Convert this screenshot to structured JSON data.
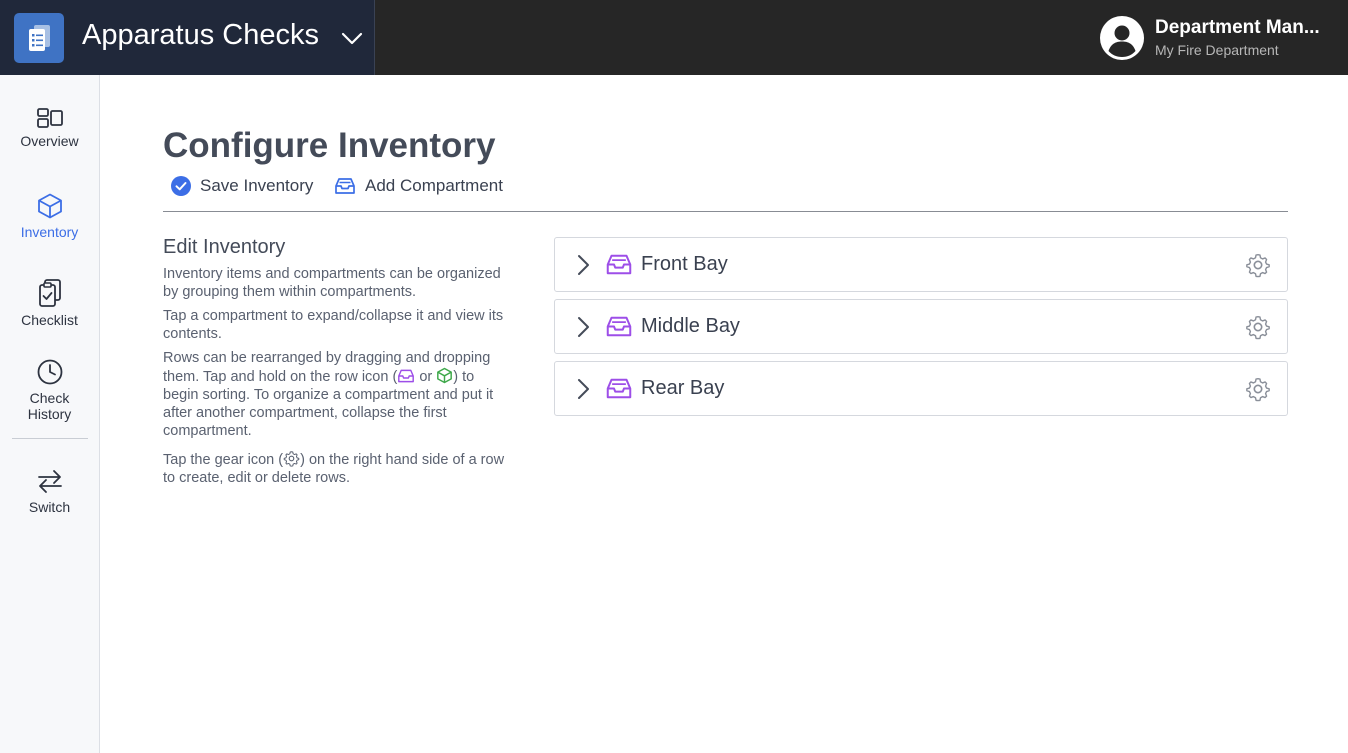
{
  "header": {
    "app_title": "Apparatus Checks",
    "user_name": "Department Man...",
    "user_org": "My Fire Department"
  },
  "sidebar": {
    "items": [
      {
        "label": "Overview",
        "icon": "overview-icon"
      },
      {
        "label": "Inventory",
        "icon": "cube-icon",
        "active": true
      },
      {
        "label": "Checklist",
        "icon": "clipboard-check-icon"
      },
      {
        "label": "Check History",
        "icon": "clock-icon"
      },
      {
        "label": "Switch",
        "icon": "switch-arrows-icon"
      }
    ]
  },
  "main": {
    "title": "Configure Inventory",
    "actions": {
      "save_label": "Save Inventory",
      "add_label": "Add Compartment"
    },
    "help": {
      "title": "Edit Inventory",
      "p1": "Inventory items and compartments can be organized by grouping them within compartments.",
      "p2": "Tap a compartment to expand/collapse it and view its contents.",
      "p3_a": "Rows can be rearranged by dragging and dropping them. Tap and hold on the row icon (",
      "p3_or": " or ",
      "p3_b": ") to begin sorting. To organize a compartment and put it after another compartment, collapse the first compartment.",
      "p4_a": "Tap the gear icon (",
      "p4_b": ") on the right hand side of a row to create, edit or delete rows."
    },
    "compartments": [
      {
        "label": "Front Bay"
      },
      {
        "label": "Middle Bay"
      },
      {
        "label": "Rear Bay"
      }
    ]
  },
  "colors": {
    "accent": "#3c6ee6",
    "compartment_icon": "#9d4ee8",
    "item_icon": "#3ea84a",
    "topbar": "#262626",
    "app_switcher": "#20283a"
  }
}
